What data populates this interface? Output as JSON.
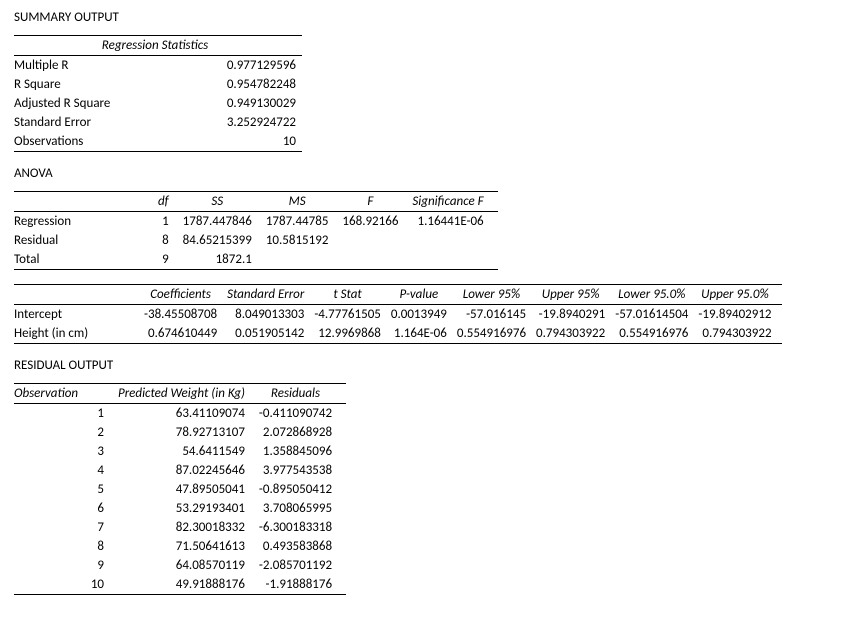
{
  "summary": {
    "title": "SUMMARY OUTPUT",
    "stats_title": "Regression Statistics",
    "rows": [
      {
        "label": "Multiple R",
        "value": "0.977129596"
      },
      {
        "label": "R Square",
        "value": "0.954782248"
      },
      {
        "label": "Adjusted R Square",
        "value": "0.949130029"
      },
      {
        "label": "Standard Error",
        "value": "3.252924722"
      },
      {
        "label": "Observations",
        "value": "10"
      }
    ]
  },
  "anova": {
    "title": "ANOVA",
    "headers": {
      "blank": "",
      "df": "df",
      "ss": "SS",
      "ms": "MS",
      "f": "F",
      "sigf": "Significance F"
    },
    "rows": [
      {
        "label": "Regression",
        "df": "1",
        "ss": "1787.447846",
        "ms": "1787.44785",
        "f": "168.92166",
        "sigf": "1.16441E-06"
      },
      {
        "label": "Residual",
        "df": "8",
        "ss": "84.65215399",
        "ms": "10.5815192",
        "f": "",
        "sigf": ""
      },
      {
        "label": "Total",
        "df": "9",
        "ss": "1872.1",
        "ms": "",
        "f": "",
        "sigf": ""
      }
    ]
  },
  "coef": {
    "headers": {
      "blank": "",
      "coefficients": "Coefficients",
      "stderr": "Standard Error",
      "tstat": "t Stat",
      "pvalue": "P-value",
      "l95": "Lower 95%",
      "u95": "Upper 95%",
      "l950": "Lower 95.0%",
      "u950": "Upper 95.0%"
    },
    "rows": [
      {
        "label": "Intercept",
        "coefficients": "-38.45508708",
        "stderr": "8.049013303",
        "tstat": "-4.77761505",
        "pvalue": "0.0013949",
        "l95": "-57.016145",
        "u95": "-19.8940291",
        "l950": "-57.01614504",
        "u950": "-19.89402912"
      },
      {
        "label": "Height (in cm)",
        "coefficients": "0.674610449",
        "stderr": "0.051905142",
        "tstat": "12.9969868",
        "pvalue": "1.164E-06",
        "l95": "0.554916976",
        "u95": "0.794303922",
        "l950": "0.554916976",
        "u950": "0.794303922"
      }
    ]
  },
  "resid": {
    "title": "RESIDUAL OUTPUT",
    "headers": {
      "obs": "Observation",
      "pred": "Predicted Weight (in Kg)",
      "res": "Residuals"
    },
    "rows": [
      {
        "obs": "1",
        "pred": "63.41109074",
        "res": "-0.411090742"
      },
      {
        "obs": "2",
        "pred": "78.92713107",
        "res": "2.072868928"
      },
      {
        "obs": "3",
        "pred": "54.6411549",
        "res": "1.358845096"
      },
      {
        "obs": "4",
        "pred": "87.02245646",
        "res": "3.977543538"
      },
      {
        "obs": "5",
        "pred": "47.89505041",
        "res": "-0.895050412"
      },
      {
        "obs": "6",
        "pred": "53.29193401",
        "res": "3.708065995"
      },
      {
        "obs": "7",
        "pred": "82.30018332",
        "res": "-6.300183318"
      },
      {
        "obs": "8",
        "pred": "71.50641613",
        "res": "0.493583868"
      },
      {
        "obs": "9",
        "pred": "64.08570119",
        "res": "-2.085701192"
      },
      {
        "obs": "10",
        "pred": "49.91888176",
        "res": "-1.91888176"
      }
    ]
  },
  "chart_data": [
    {
      "type": "table",
      "title": "Regression Statistics",
      "rows": [
        [
          "Multiple R",
          0.977129596
        ],
        [
          "R Square",
          0.954782248
        ],
        [
          "Adjusted R Square",
          0.949130029
        ],
        [
          "Standard Error",
          3.252924722
        ],
        [
          "Observations",
          10
        ]
      ]
    },
    {
      "type": "table",
      "title": "ANOVA",
      "columns": [
        "",
        "df",
        "SS",
        "MS",
        "F",
        "Significance F"
      ],
      "rows": [
        [
          "Regression",
          1,
          1787.447846,
          1787.44785,
          168.92166,
          1.16441e-06
        ],
        [
          "Residual",
          8,
          84.65215399,
          10.5815192,
          null,
          null
        ],
        [
          "Total",
          9,
          1872.1,
          null,
          null,
          null
        ]
      ]
    },
    {
      "type": "table",
      "title": "Coefficients",
      "columns": [
        "",
        "Coefficients",
        "Standard Error",
        "t Stat",
        "P-value",
        "Lower 95%",
        "Upper 95%",
        "Lower 95.0%",
        "Upper 95.0%"
      ],
      "rows": [
        [
          "Intercept",
          -38.45508708,
          8.049013303,
          -4.77761505,
          0.0013949,
          -57.016145,
          -19.8940291,
          -57.01614504,
          -19.89402912
        ],
        [
          "Height (in cm)",
          0.674610449,
          0.051905142,
          12.9969868,
          1.164e-06,
          0.554916976,
          0.794303922,
          0.554916976,
          0.794303922
        ]
      ]
    },
    {
      "type": "table",
      "title": "RESIDUAL OUTPUT",
      "columns": [
        "Observation",
        "Predicted Weight (in Kg)",
        "Residuals"
      ],
      "rows": [
        [
          1,
          63.41109074,
          -0.411090742
        ],
        [
          2,
          78.92713107,
          2.072868928
        ],
        [
          3,
          54.6411549,
          1.358845096
        ],
        [
          4,
          87.02245646,
          3.977543538
        ],
        [
          5,
          47.89505041,
          -0.895050412
        ],
        [
          6,
          53.29193401,
          3.708065995
        ],
        [
          7,
          82.30018332,
          -6.300183318
        ],
        [
          8,
          71.50641613,
          0.493583868
        ],
        [
          9,
          64.08570119,
          -2.085701192
        ],
        [
          10,
          49.91888176,
          -1.91888176
        ]
      ]
    }
  ]
}
